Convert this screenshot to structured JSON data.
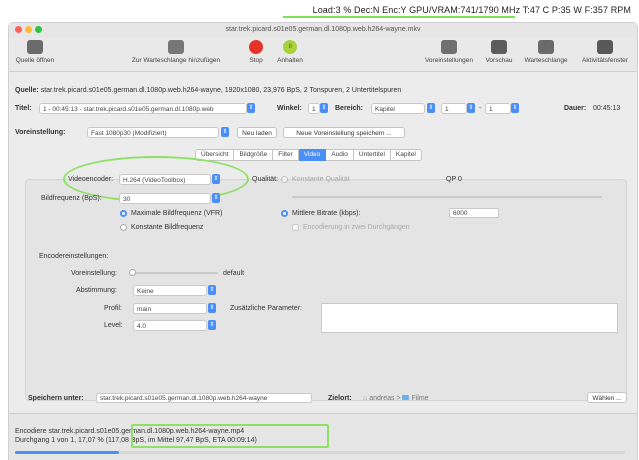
{
  "menubar": {
    "stats": "Load:3 %  Dec:N Enc:Y  GPU/VRAM:741/1790 MHz  T:47 C  P:35 W  F:357 RPM"
  },
  "window": {
    "doc_title": "star.trek.picard.s01e05.german.dl.1080p.web.h264-wayne.mkv"
  },
  "toolbar": {
    "left": [
      {
        "label": "Quelle öffnen",
        "icon": "film-icon"
      },
      {
        "label": "Zur Warteschlange hinzufügen",
        "icon": "queue-add-icon"
      },
      {
        "label": "Stop",
        "icon": "stop-icon"
      },
      {
        "label": "Anhalten",
        "icon": "pause-icon"
      }
    ],
    "right": [
      {
        "label": "Voreinstellungen",
        "icon": "presets-icon"
      },
      {
        "label": "Vorschau",
        "icon": "preview-icon"
      },
      {
        "label": "Warteschlange",
        "icon": "queue-icon"
      },
      {
        "label": "Aktivitätsfenster",
        "icon": "activity-icon"
      }
    ]
  },
  "source": {
    "label": "Quelle:",
    "value": "star.trek.picard.s01e05.german.dl.1080p.web.h264-wayne, 1920x1080, 23,976 BpS, 2 Tonspuren, 2 Untertitelspuren"
  },
  "title_row": {
    "title_label": "Titel:",
    "title_value": "1 - 00:45:13 - star.trek.picard.s01e05.german.dl.1080p.web",
    "angle_label": "Winkel:",
    "angle_value": "1",
    "range_label": "Bereich:",
    "range_type": "Kapitel",
    "range_from": "1",
    "range_dash": "-",
    "range_to": "1",
    "duration_label": "Dauer:",
    "duration_value": "00:45:13"
  },
  "preset_row": {
    "label": "Voreinstellung:",
    "value": "Fast 1080p30 (Modifiziert)",
    "reload_button": "Neu laden",
    "save_new_button": "Neue Voreinstellung speichern ..."
  },
  "tabs": [
    "Übersicht",
    "Bildgröße",
    "Filter",
    "Video",
    "Audio",
    "Untertitel",
    "Kapitel"
  ],
  "active_tab": "Video",
  "video": {
    "encoder_label": "Videoencoder:",
    "encoder_value": "H.264 (VideoToolbox)",
    "framerate_label": "Bildfrequenz (BpS):",
    "framerate_value": "30",
    "max_framerate": "Maximale Bildfrequenz (VFR)",
    "const_framerate": "Konstante Bildfrequenz",
    "quality_label": "Qualität:",
    "const_quality": "Konstante Qualität",
    "qp_label": "QP",
    "qp_value": "0",
    "avg_bitrate": "Mittlere Bitrate (kbps):",
    "bitrate_value": "6000",
    "two_pass": "Encodierung in zwei Durchgängen"
  },
  "encoder_settings": {
    "heading": "Encodereinstellungen:",
    "preset_label": "Voreinstellung:",
    "preset_value": "default",
    "tune_label": "Abstimmung:",
    "tune_value": "Keine",
    "profile_label": "Profil:",
    "profile_value": "main",
    "level_label": "Level:",
    "level_value": "4.0",
    "extra_label": "Zusätzliche Parameter:"
  },
  "save": {
    "label": "Speichern unter:",
    "value": "star.trek.picard.s01e05.german.dl.1080p.web.h264-wayne",
    "dest_label": "Zielort:",
    "dest_path_user": "andreas",
    "dest_sep": ">",
    "dest_path_folder": "Filme",
    "browse_button": "Wählen ..."
  },
  "status": {
    "line1_prefix": "Encodiere star.trek.picard.s0",
    "line1_file": "1e05.german.dl.1080p.web.h264-wayne.mp4",
    "line2_prefix": "Durchgang 1 von 1, 17,07 %",
    "line2_stats": "(117,08 BpS, im Mittel 97,47 BpS, ETA 00:09:14)",
    "progress_fraction": 0.1707
  },
  "colors": {
    "accent": "#4a8ff6",
    "highlight": "#8fe066",
    "stop": "#e5332a",
    "pause": "#a8d13a"
  }
}
